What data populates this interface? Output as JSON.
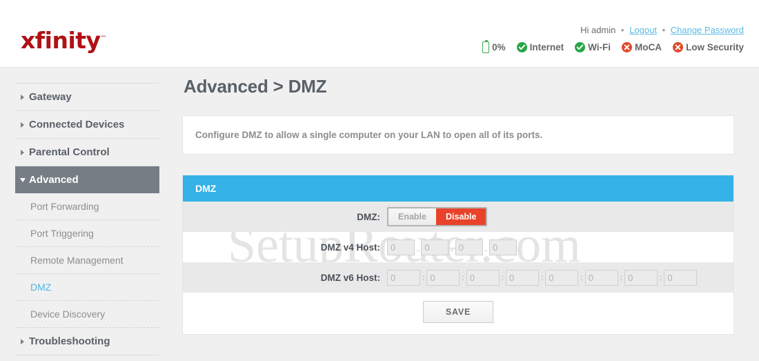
{
  "header": {
    "logo_text": "xfinity",
    "logo_tm": "™",
    "greeting": "Hi admin",
    "separator": "•",
    "logout_label": "Logout",
    "change_password_label": "Change Password",
    "status": [
      {
        "icon": "battery-icon",
        "label": "0%",
        "state": "neutral"
      },
      {
        "icon": "check-circle-icon",
        "label": "Internet",
        "state": "ok"
      },
      {
        "icon": "check-circle-icon",
        "label": "Wi-Fi",
        "state": "ok"
      },
      {
        "icon": "error-circle-icon",
        "label": "MoCA",
        "state": "error"
      },
      {
        "icon": "error-circle-icon",
        "label": "Low Security",
        "state": "error"
      }
    ],
    "colors": {
      "brand": "#b01116",
      "ok": "#26a744",
      "error": "#e0492a",
      "link": "#5bb9e0"
    }
  },
  "sidebar": {
    "items": [
      {
        "label": "Gateway",
        "type": "main",
        "active": false
      },
      {
        "label": "Connected Devices",
        "type": "main",
        "active": false
      },
      {
        "label": "Parental Control",
        "type": "main",
        "active": false
      },
      {
        "label": "Advanced",
        "type": "main",
        "active": true
      },
      {
        "label": "Port Forwarding",
        "type": "sub",
        "current": false
      },
      {
        "label": "Port Triggering",
        "type": "sub",
        "current": false
      },
      {
        "label": "Remote Management",
        "type": "sub",
        "current": false
      },
      {
        "label": "DMZ",
        "type": "sub",
        "current": true
      },
      {
        "label": "Device Discovery",
        "type": "sub",
        "current": false
      },
      {
        "label": "Troubleshooting",
        "type": "main",
        "active": false
      }
    ]
  },
  "main": {
    "page_title": "Advanced > DMZ",
    "description": "Configure DMZ to allow a single computer on your LAN to open all of its ports.",
    "panel": {
      "title": "DMZ",
      "accent_color": "#35b2e8",
      "rows": {
        "dmz": {
          "label": "DMZ:",
          "enable_label": "Enable",
          "disable_label": "Disable",
          "selected": "Disable"
        },
        "v4": {
          "label": "DMZ v4 Host:",
          "separator": ".",
          "octets": [
            "0",
            "0",
            "0",
            "0"
          ]
        },
        "v6": {
          "label": "DMZ v6 Host:",
          "separator": ":",
          "groups": [
            "0",
            "0",
            "0",
            "0",
            "0",
            "0",
            "0",
            "0"
          ]
        }
      },
      "save_label": "SAVE"
    }
  },
  "watermark": {
    "text": "SetupRouter.com"
  }
}
